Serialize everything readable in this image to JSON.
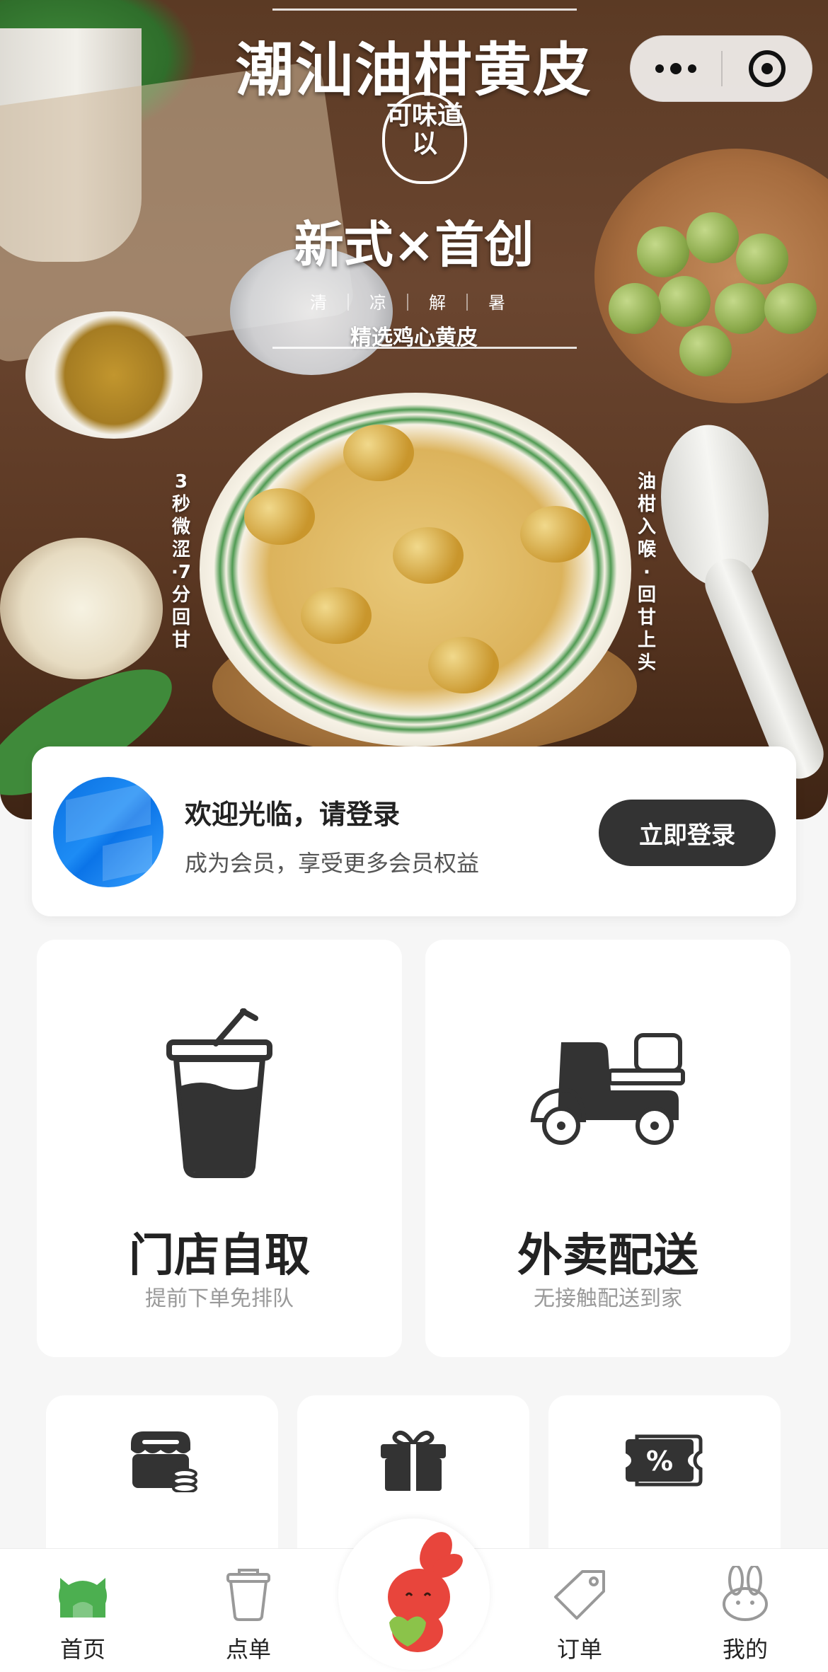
{
  "banner": {
    "title": "潮汕油柑黄皮",
    "seal_text": "可味道以",
    "slogan": "新式×首创",
    "chips": "清｜凉｜解｜暑",
    "select_line": "精选鸡心黄皮",
    "left_vertical": "3秒微涩·7分回甘",
    "right_vertical": "油柑入喉·回甘上头"
  },
  "login": {
    "welcome": "欢迎光临，请登录",
    "subtitle": "成为会员，享受更多会员权益",
    "button": "立即登录"
  },
  "services": [
    {
      "name": "门店自取",
      "desc": "提前下单免排队",
      "icon": "bubble-tea-cup-icon"
    },
    {
      "name": "外卖配送",
      "desc": "无接触配送到家",
      "icon": "delivery-scooter-icon"
    }
  ],
  "minis": [
    {
      "icon": "store-coins-icon"
    },
    {
      "icon": "gift-box-icon"
    },
    {
      "icon": "discount-coupon-icon"
    }
  ],
  "tabs": [
    {
      "label": "首页",
      "icon": "home-icon",
      "active": true
    },
    {
      "label": "点单",
      "icon": "cup-icon",
      "active": false
    },
    {
      "label": "",
      "icon": "rabbit-mascot-icon",
      "active": false
    },
    {
      "label": "订单",
      "icon": "tag-icon",
      "active": false
    },
    {
      "label": "我的",
      "icon": "rabbit-face-icon",
      "active": false
    }
  ],
  "colors": {
    "primary_button": "#333333",
    "home_active": "#4caf50",
    "mascot_red": "#e8453c"
  }
}
